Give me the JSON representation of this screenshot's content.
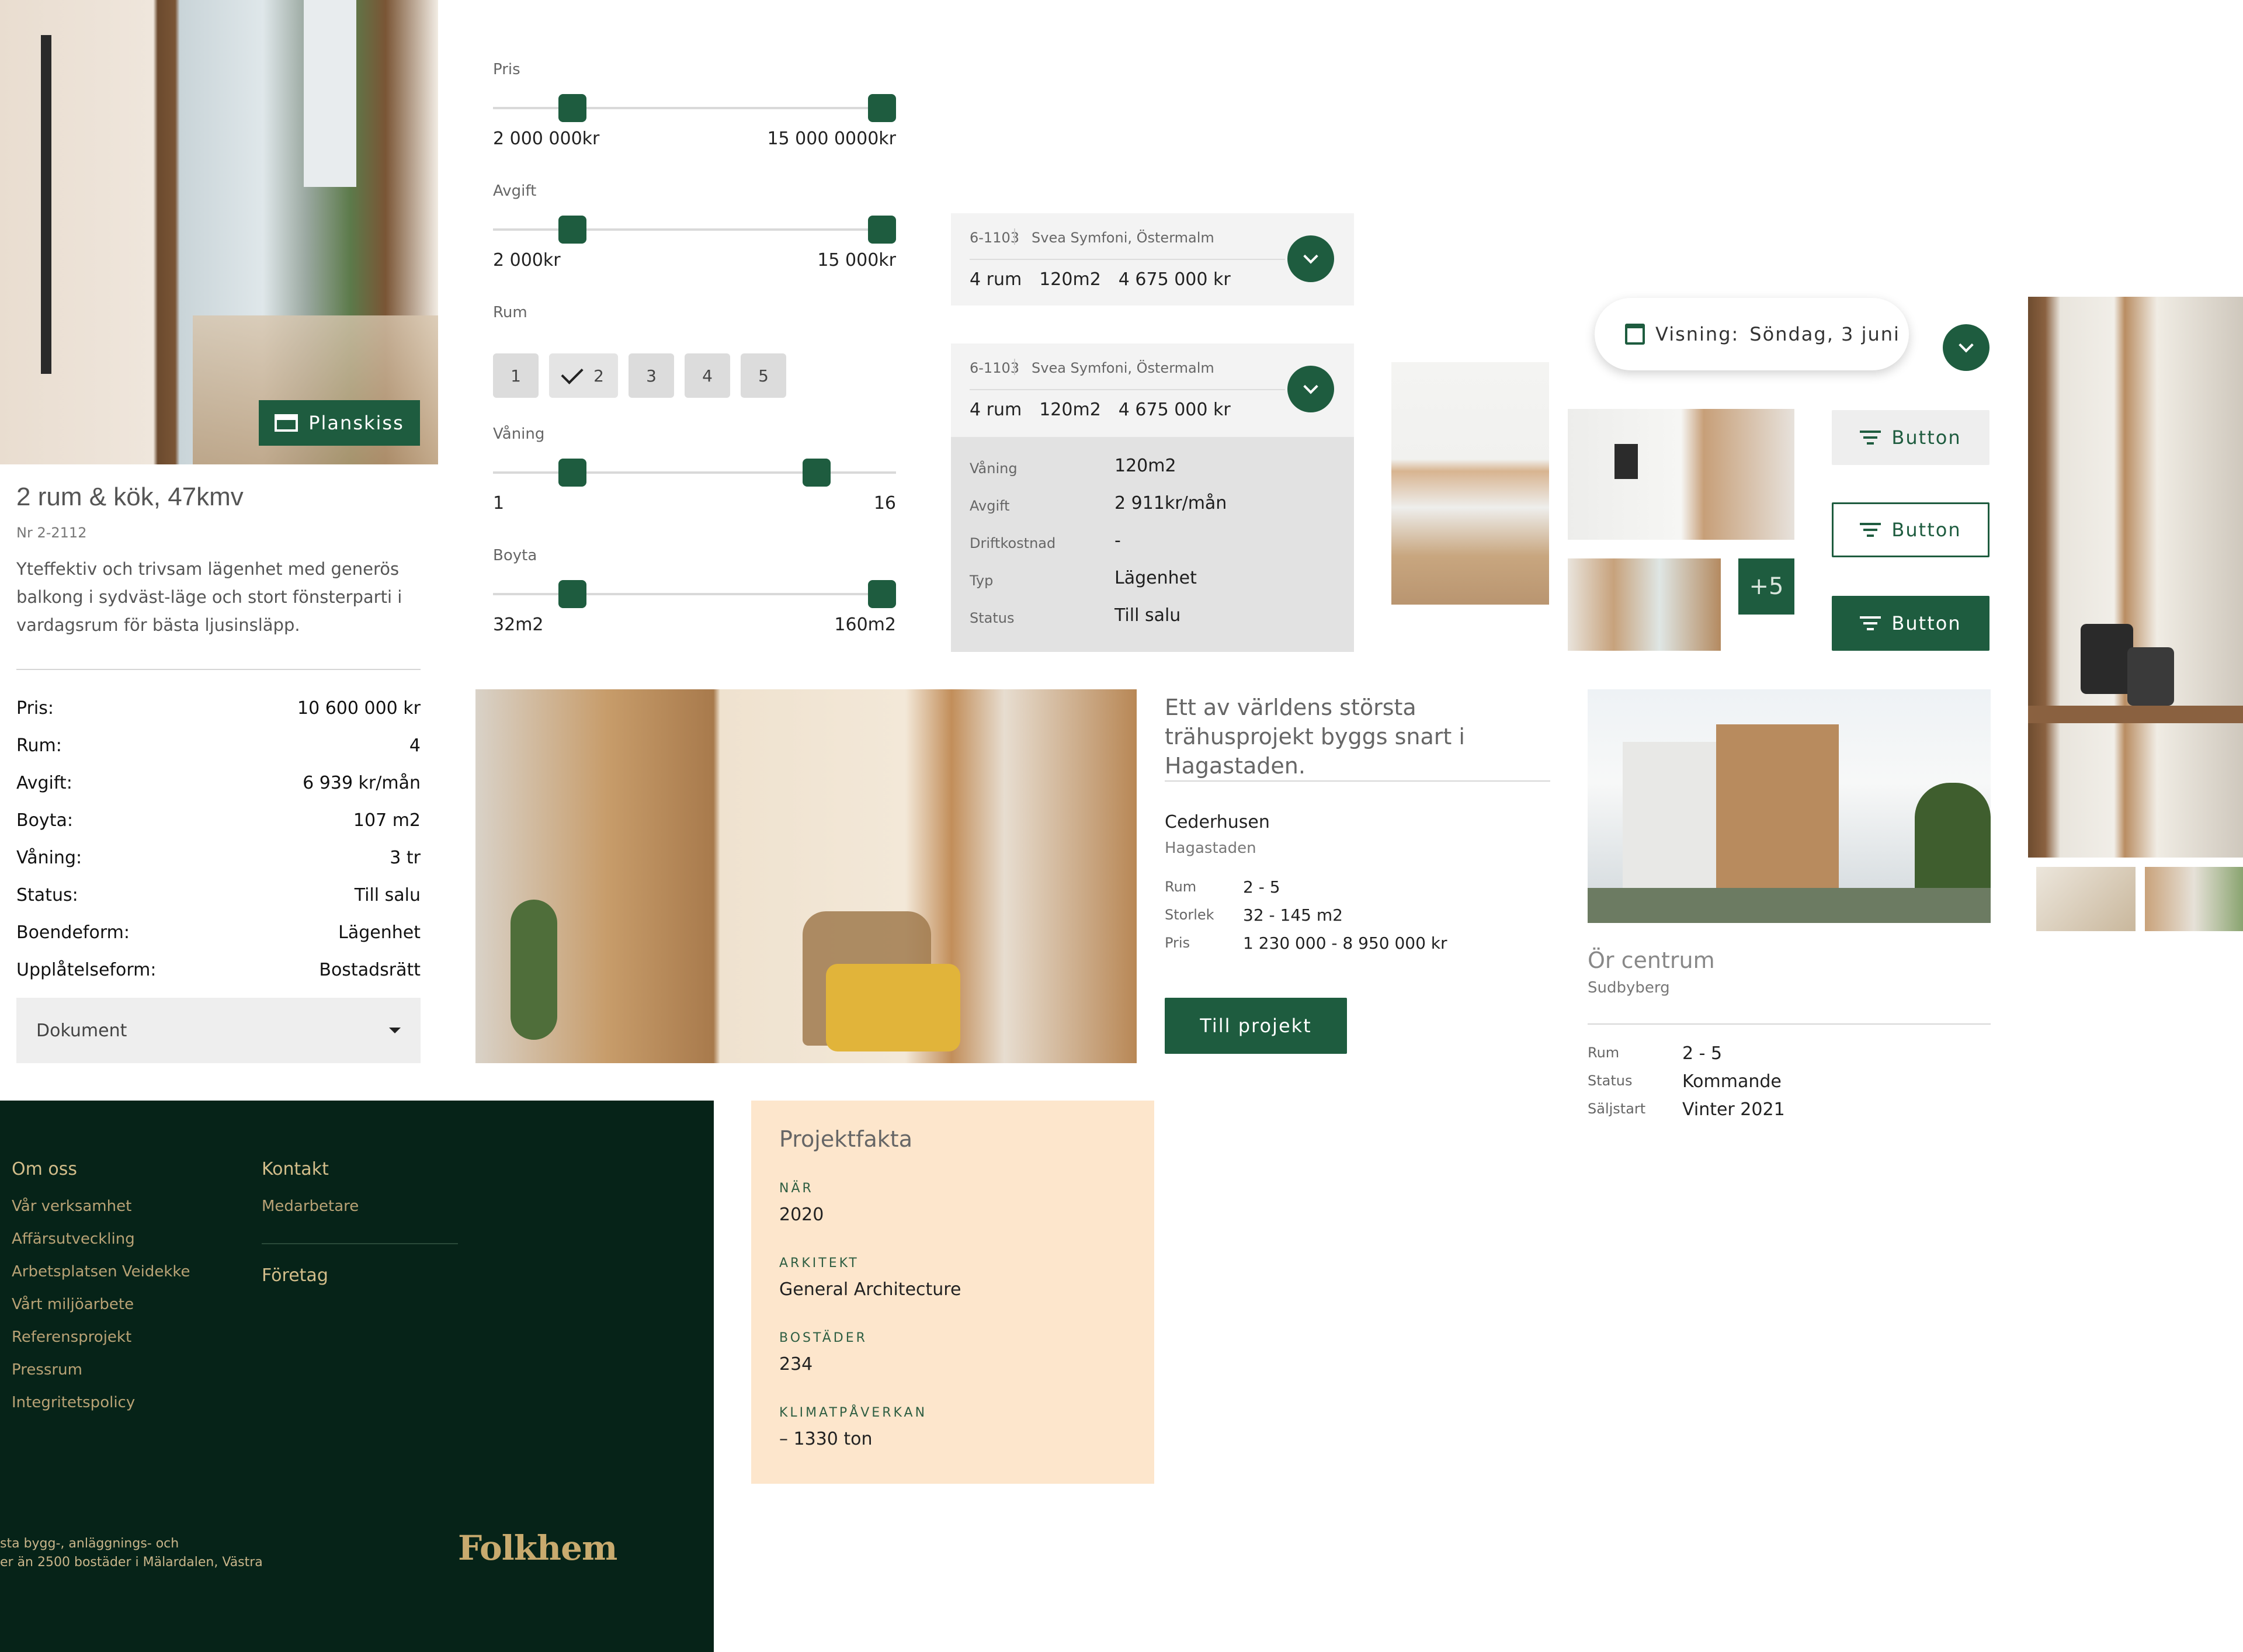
{
  "listing": {
    "planskiss_label": "Planskiss",
    "title": "2 rum & kök, 47kmv",
    "number": "Nr 2-2112",
    "description": "Yteffektiv och trivsam lägenhet med generös balkong i sydväst-läge och stort fönsterparti i vardagsrum för bästa ljusinsläpp.",
    "facts": [
      {
        "label": "Pris:",
        "value": "10 600 000 kr"
      },
      {
        "label": "Rum:",
        "value": "4"
      },
      {
        "label": "Avgift:",
        "value": "6 939 kr/mån"
      },
      {
        "label": "Boyta:",
        "value": "107 m2"
      },
      {
        "label": "Våning:",
        "value": "3 tr"
      },
      {
        "label": "Status:",
        "value": "Till salu"
      },
      {
        "label": "Boendeform:",
        "value": "Lägenhet"
      },
      {
        "label": "Upplåtelseform:",
        "value": "Bostadsrätt"
      }
    ],
    "document_dropdown": "Dokument"
  },
  "filters": {
    "price": {
      "label": "Pris",
      "min": "2 000 000kr",
      "max": "15 000 0000kr"
    },
    "fee": {
      "label": "Avgift",
      "min": "2 000kr",
      "max": "15 000kr"
    },
    "rooms": {
      "label": "Rum",
      "options": [
        "1",
        "2",
        "3",
        "4",
        "5"
      ],
      "selected": "2"
    },
    "floor": {
      "label": "Våning",
      "min": "1",
      "max": "16"
    },
    "area": {
      "label": "Boyta",
      "min": "32m2",
      "max": "160m2"
    }
  },
  "unit_card_collapsed": {
    "id": "6-1103",
    "project": "Svea Symfoni, Östermalm",
    "rooms": "4 rum",
    "size": "120m2",
    "price": "4 675 000 kr"
  },
  "unit_card_expanded": {
    "id": "6-1103",
    "project": "Svea Symfoni, Östermalm",
    "rooms": "4 rum",
    "size": "120m2",
    "price": "4 675 000 kr",
    "details": [
      {
        "label": "Våning",
        "value": "120m2"
      },
      {
        "label": "Avgift",
        "value": "2 911kr/mån"
      },
      {
        "label": "Driftkostnad",
        "value": "-"
      },
      {
        "label": "Typ",
        "value": "Lägenhet"
      },
      {
        "label": "Status",
        "value": "Till salu"
      }
    ]
  },
  "viewing": {
    "label": "Visning:",
    "date": "Söndag, 3 juni"
  },
  "gallery": {
    "more": "+5"
  },
  "buttons": {
    "b1": "Button",
    "b2": "Button",
    "b3": "Button"
  },
  "project_card": {
    "headline": "Ett av världens största trähusprojekt byggs snart i Hagastaden.",
    "name": "Cederhusen",
    "area": "Hagastaden",
    "rows": [
      {
        "label": "Rum",
        "value": "2 - 5"
      },
      {
        "label": "Storlek",
        "value": "32 - 145 m2"
      },
      {
        "label": "Pris",
        "value": "1 230 000 - 8 950 000 kr"
      }
    ],
    "cta": "Till projekt"
  },
  "project_card_2": {
    "name": "Ör centrum",
    "area": "Sudbyberg",
    "rows": [
      {
        "label": "Rum",
        "value": "2 - 5"
      },
      {
        "label": "Status",
        "value": "Kommande"
      },
      {
        "label": "Säljstart",
        "value": "Vinter 2021"
      }
    ]
  },
  "footer": {
    "col1_title": "Om oss",
    "col1_links": [
      "Vår verksamhet",
      "Affärsutveckling",
      "Arbetsplatsen Veidekke",
      "Vårt miljöarbete",
      "Referensprojekt",
      "Pressrum",
      "Integritetspolicy"
    ],
    "col2_title": "Kontakt",
    "col2_links": [
      "Medarbetare"
    ],
    "col3_title": "Företag",
    "about_line1": "sta bygg-, anläggnings- och",
    "about_line2": "er än 2500 bostäder i Mälardalen, Västra",
    "logo": "Folkhem"
  },
  "projektfakta": {
    "title": "Projektfakta",
    "items": [
      {
        "key": "NÄR",
        "value": "2020"
      },
      {
        "key": "ARKITEKT",
        "value": "General Architecture"
      },
      {
        "key": "BOSTÄDER",
        "value": "234"
      },
      {
        "key": "KLIMATPÅVERKAN",
        "value": "– 1330 ton"
      }
    ]
  },
  "colors": {
    "brand_green": "#1e5c3f",
    "footer_bg": "#062318",
    "footer_gold": "#b8a275",
    "fakta_bg": "#fde6cc"
  }
}
